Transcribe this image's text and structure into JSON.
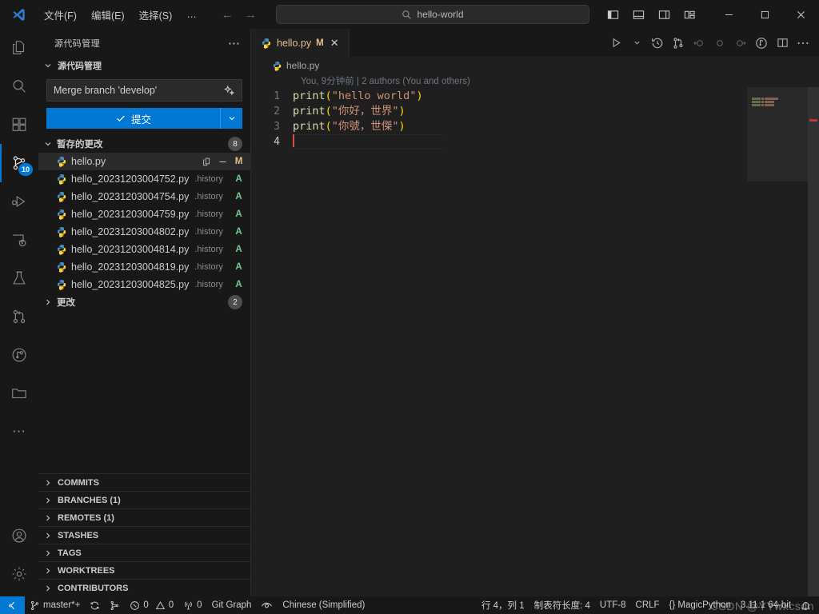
{
  "titlebar": {
    "logo_icon": "vscode-logo-icon",
    "menus": [
      {
        "label": "文件(F)",
        "name": "menu-file"
      },
      {
        "label": "编辑(E)",
        "name": "menu-edit"
      },
      {
        "label": "选择(S)",
        "name": "menu-selection"
      },
      {
        "label": "…",
        "name": "menu-more"
      }
    ],
    "nav": {
      "back_icon": "arrow-left-icon",
      "forward_icon": "arrow-right-icon"
    },
    "search": {
      "icon": "search-icon",
      "value": "hello-world",
      "placeholder": "搜索"
    },
    "layout_buttons": [
      {
        "name": "toggle-primary-sidebar-button",
        "icon": "layout-sidebar-left-icon"
      },
      {
        "name": "toggle-panel-button",
        "icon": "layout-panel-icon"
      },
      {
        "name": "toggle-secondary-sidebar-button",
        "icon": "layout-sidebar-right-icon"
      },
      {
        "name": "customize-layout-button",
        "icon": "layout-customize-icon"
      }
    ],
    "window_controls": [
      {
        "name": "minimize-button",
        "icon": "minimize-icon"
      },
      {
        "name": "maximize-button",
        "icon": "maximize-icon"
      },
      {
        "name": "close-button",
        "icon": "close-icon"
      }
    ]
  },
  "activitybar": {
    "items": [
      {
        "name": "activity-explorer",
        "icon": "files-icon",
        "active": false
      },
      {
        "name": "activity-search",
        "icon": "search-icon",
        "active": false
      },
      {
        "name": "activity-extensions",
        "icon": "extensions-icon",
        "active": false
      },
      {
        "name": "activity-source-control",
        "icon": "source-control-icon",
        "active": true,
        "badge": "10"
      },
      {
        "name": "activity-run-debug",
        "icon": "run-and-debug-icon",
        "active": false
      },
      {
        "name": "activity-remote-explorer",
        "icon": "remote-explorer-icon",
        "active": false
      },
      {
        "name": "activity-testing",
        "icon": "beaker-icon",
        "active": false
      },
      {
        "name": "activity-pull-requests",
        "icon": "git-pull-request-icon",
        "active": false
      },
      {
        "name": "activity-git-graph",
        "icon": "git-graph-icon",
        "active": false
      },
      {
        "name": "activity-folder",
        "icon": "folder-icon",
        "active": false
      },
      {
        "name": "activity-more",
        "icon": "ellipsis-icon",
        "active": false
      }
    ],
    "bottom": [
      {
        "name": "activity-account",
        "icon": "account-icon"
      },
      {
        "name": "activity-settings",
        "icon": "gear-icon"
      }
    ]
  },
  "sidebar": {
    "header_title": "源代码管理",
    "header_menu_icon": "ellipsis-icon",
    "provider_section": {
      "label": "源代码管理",
      "chevron": "chevron-down-icon"
    },
    "commit": {
      "message": "Merge branch 'develop'",
      "placeholder": "消息",
      "sparkle_icon": "sparkle-ai-icon",
      "button_label": "提交",
      "button_check_icon": "check-icon",
      "dropdown_icon": "chevron-down-icon"
    },
    "staged": {
      "label": "暂存的更改",
      "chevron": "chevron-down-icon",
      "count": "8",
      "files": [
        {
          "name": "hello.py",
          "dir": "",
          "status": "M",
          "selected": true,
          "actions": [
            "open-file-icon",
            "unstage-changes-icon"
          ]
        },
        {
          "name": "hello_20231203004752.py",
          "dir": ".history",
          "status": "A",
          "selected": false,
          "actions": []
        },
        {
          "name": "hello_20231203004754.py",
          "dir": ".history",
          "status": "A",
          "selected": false,
          "actions": []
        },
        {
          "name": "hello_20231203004759.py",
          "dir": ".history",
          "status": "A",
          "selected": false,
          "actions": []
        },
        {
          "name": "hello_20231203004802.py",
          "dir": ".history",
          "status": "A",
          "selected": false,
          "actions": []
        },
        {
          "name": "hello_20231203004814.py",
          "dir": ".history",
          "status": "A",
          "selected": false,
          "actions": []
        },
        {
          "name": "hello_20231203004819.py",
          "dir": ".history",
          "status": "A",
          "selected": false,
          "actions": []
        },
        {
          "name": "hello_20231203004825.py",
          "dir": ".history",
          "status": "A",
          "selected": false,
          "actions": []
        }
      ]
    },
    "changes": {
      "label": "更改",
      "chevron": "chevron-right-icon",
      "count": "2"
    },
    "collapsed_sections": [
      {
        "label": "COMMITS",
        "name": "section-commits"
      },
      {
        "label": "BRANCHES (1)",
        "name": "section-branches"
      },
      {
        "label": "REMOTES (1)",
        "name": "section-remotes"
      },
      {
        "label": "STASHES",
        "name": "section-stashes"
      },
      {
        "label": "TAGS",
        "name": "section-tags"
      },
      {
        "label": "WORKTREES",
        "name": "section-worktrees"
      },
      {
        "label": "CONTRIBUTORS",
        "name": "section-contributors"
      }
    ]
  },
  "editor": {
    "tab": {
      "label": "hello.py",
      "dirty_indicator": "M",
      "close_icon": "close-icon",
      "file_icon": "python-file-icon"
    },
    "actions": [
      {
        "name": "run-python-file-button",
        "icon": "run-play-icon"
      },
      {
        "name": "run-options-dropdown",
        "icon": "chevron-down-icon"
      },
      {
        "name": "timeline-history-button",
        "icon": "history-icon"
      },
      {
        "name": "git-compare-button",
        "icon": "git-compare-icon"
      },
      {
        "name": "previous-change-button",
        "icon": "arrow-circle-left-icon"
      },
      {
        "name": "change-marker-button",
        "icon": "circle-icon"
      },
      {
        "name": "next-change-button",
        "icon": "arrow-circle-right-icon"
      },
      {
        "name": "git-blame-toggle-button",
        "icon": "git-blame-icon"
      },
      {
        "name": "split-editor-button",
        "icon": "split-editor-icon"
      },
      {
        "name": "editor-more-actions-button",
        "icon": "ellipsis-icon"
      }
    ],
    "breadcrumb": {
      "icon": "python-file-icon",
      "label": "hello.py"
    },
    "blame": "You, 9分钟前 | 2 authors (You and others)",
    "lines": [
      {
        "num": "1",
        "fn": "print",
        "arg": "\"hello world\"",
        "current": false
      },
      {
        "num": "2",
        "fn": "print",
        "arg": "\"你好，世界\"",
        "current": false
      },
      {
        "num": "3",
        "fn": "print",
        "arg": "\"你號，世傑\"",
        "current": false
      },
      {
        "num": "4",
        "fn": "",
        "arg": "",
        "current": true
      }
    ]
  },
  "statusbar": {
    "remote_icon": "remote-window-icon",
    "left": [
      {
        "name": "status-branch",
        "icon": "git-branch-icon",
        "label": "master*+"
      },
      {
        "name": "status-sync",
        "icon": "sync-icon",
        "label": ""
      },
      {
        "name": "status-git-actions",
        "icon": "git-fork-icon",
        "label": ""
      },
      {
        "name": "status-problems-errors",
        "icon": "error-icon",
        "label": "0"
      },
      {
        "name": "status-problems-warnings",
        "icon": "warning-icon",
        "label": "0"
      },
      {
        "name": "status-ports",
        "icon": "radio-tower-icon",
        "label": "0"
      },
      {
        "name": "status-git-graph",
        "icon": "",
        "label": "Git Graph"
      },
      {
        "name": "status-watch-icon",
        "icon": "eye-icon",
        "label": ""
      },
      {
        "name": "status-language-pack",
        "icon": "",
        "label": "Chinese (Simplified)"
      }
    ],
    "right": [
      {
        "name": "status-cursor-position",
        "label": "行 4，列 1"
      },
      {
        "name": "status-indentation",
        "label": "制表符长度: 4"
      },
      {
        "name": "status-encoding",
        "label": "UTF-8"
      },
      {
        "name": "status-eol",
        "label": "CRLF"
      },
      {
        "name": "status-language-mode",
        "label": "{} MagicPython"
      },
      {
        "name": "status-python-interpreter",
        "label": "3.11.1 64-bit"
      },
      {
        "name": "status-notifications",
        "icon": "bell-icon",
        "label": ""
      }
    ]
  },
  "watermark": "CSDN @YYwxcsdn",
  "colors": {
    "accent": "#0078d4",
    "added": "#73c991",
    "modified": "#e2c08d",
    "background": "#1f1f1f",
    "chrome": "#181818",
    "error_marker": "#c0392b"
  }
}
